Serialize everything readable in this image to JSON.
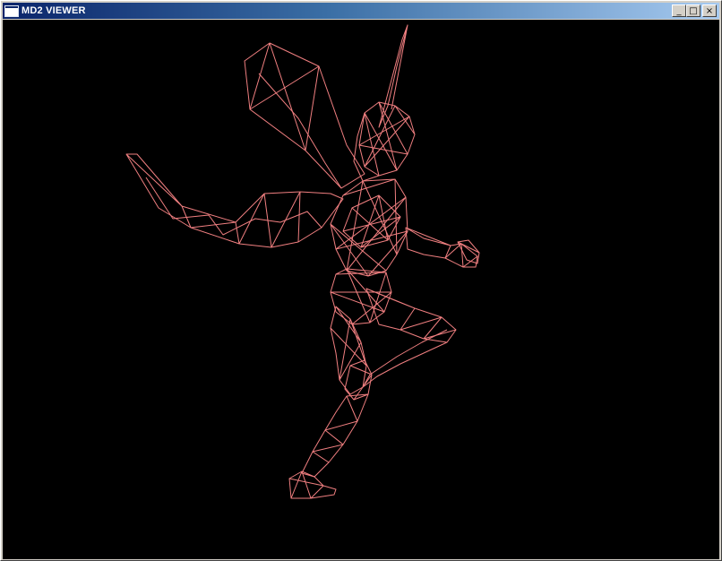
{
  "window": {
    "title": "MD2 VIEWER",
    "icon": "window-app-icon"
  },
  "controls": {
    "minimize_label": "_",
    "maximize_label": "□",
    "close_label": "×"
  },
  "viewport": {
    "background": "#000000",
    "wire_color": "#f07f80",
    "render_mode": "wireframe"
  }
}
